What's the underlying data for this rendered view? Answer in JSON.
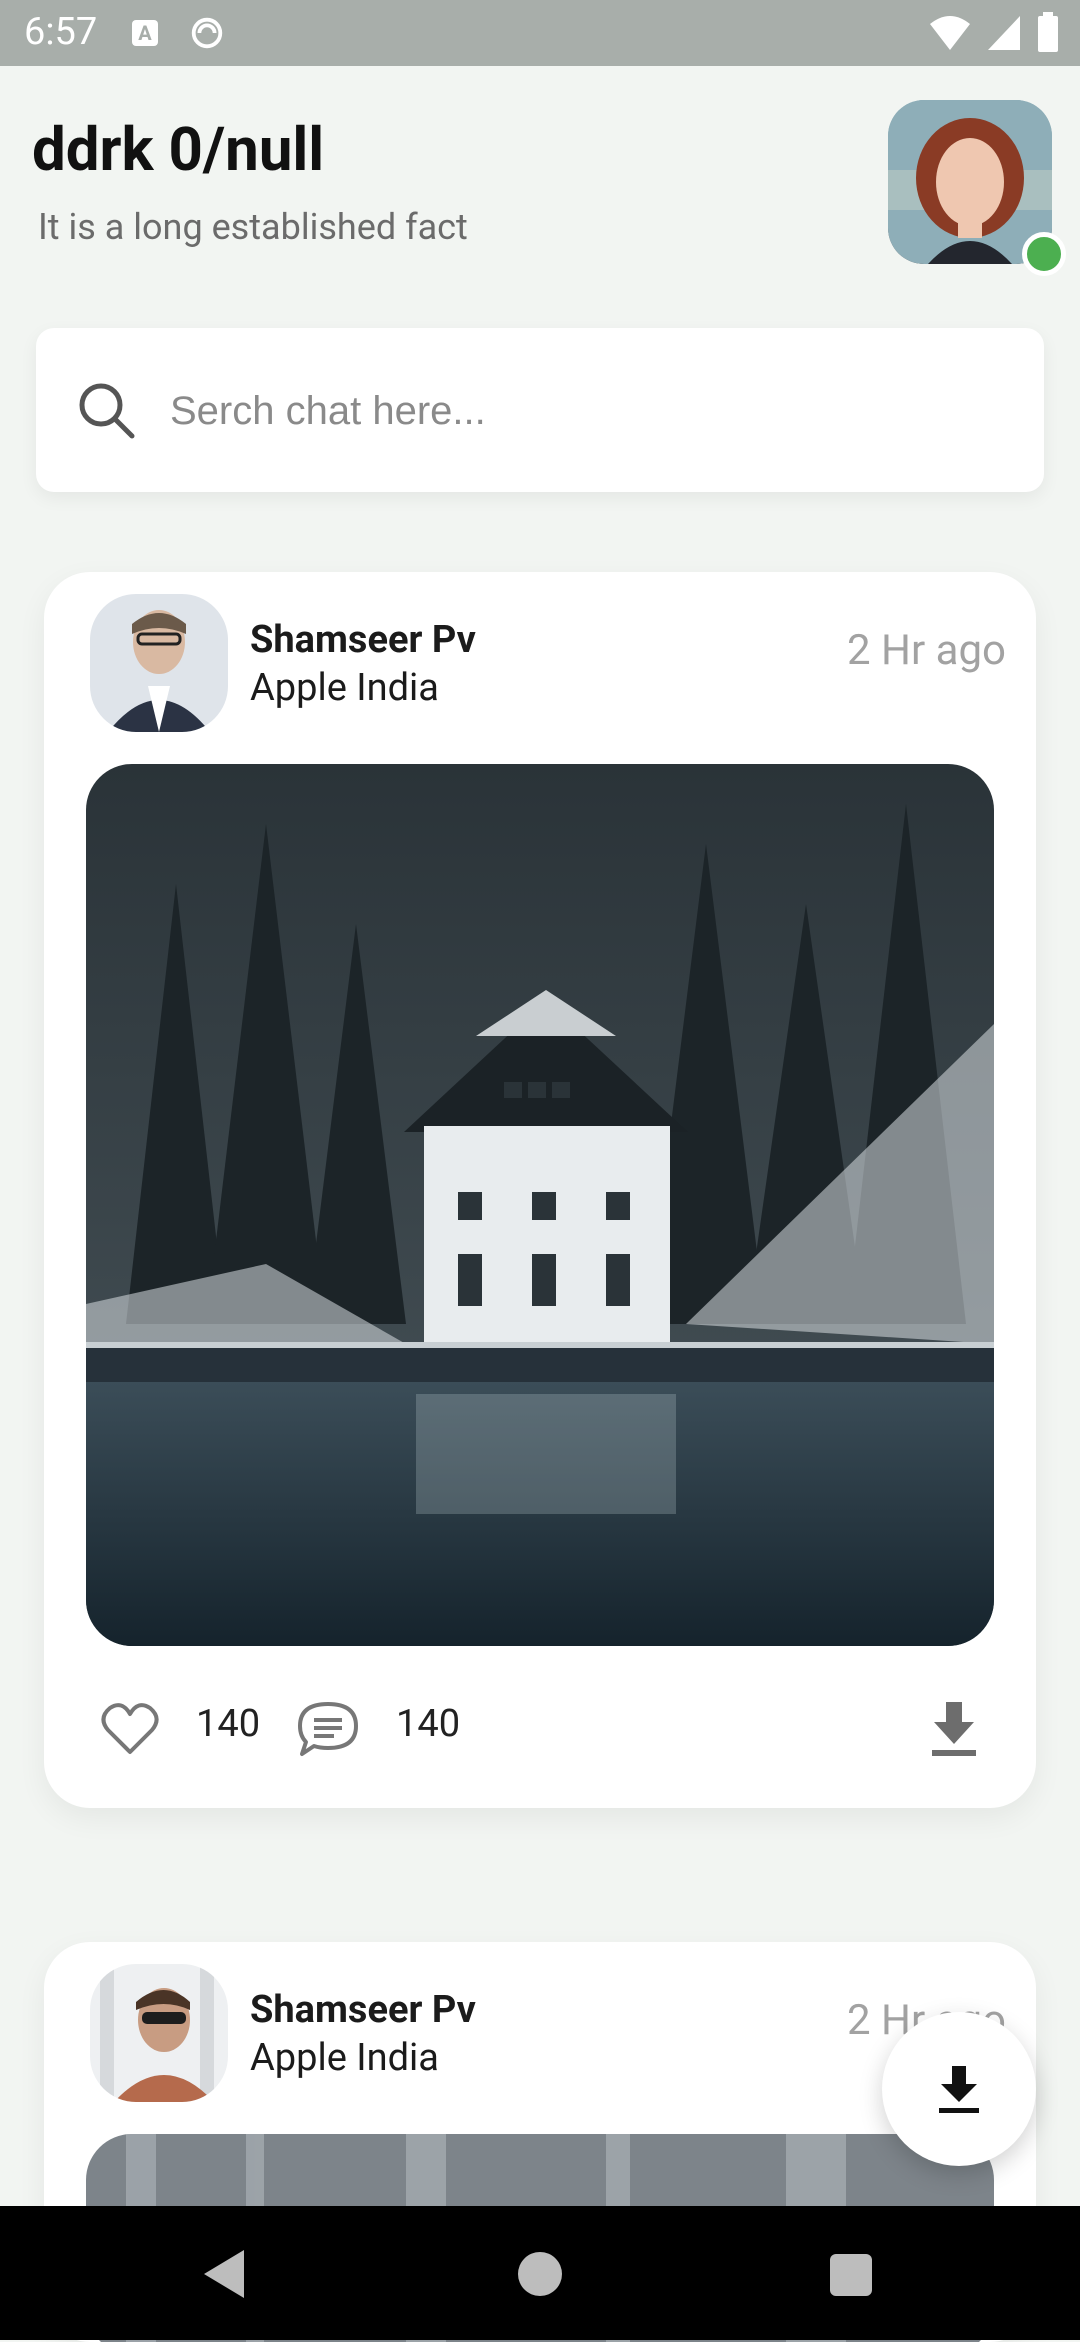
{
  "status_bar": {
    "time": "6:57",
    "icons": [
      "a-notification-icon",
      "sync-icon",
      "wifi-icon",
      "signal-icon",
      "battery-icon"
    ]
  },
  "header": {
    "title": "ddrk 0/null",
    "subtitle": "It is a long established fact",
    "online_status_color": "#4caf50"
  },
  "search": {
    "placeholder": "Serch chat here...",
    "value": ""
  },
  "posts": [
    {
      "author": "Shamseer Pv",
      "company": "Apple India",
      "time": "2 Hr ago",
      "likes": "140",
      "comments": "140"
    },
    {
      "author": "Shamseer Pv",
      "company": "Apple India",
      "time": "2 Hr ago"
    }
  ],
  "fab": {
    "icon": "download-icon"
  },
  "nav": {
    "items": [
      "back-button",
      "home-button",
      "recents-button"
    ]
  },
  "colors": {
    "background": "#f2f5f2",
    "card": "#ffffff",
    "status_bar": "#a8aeaa",
    "accent_online": "#4caf50"
  }
}
